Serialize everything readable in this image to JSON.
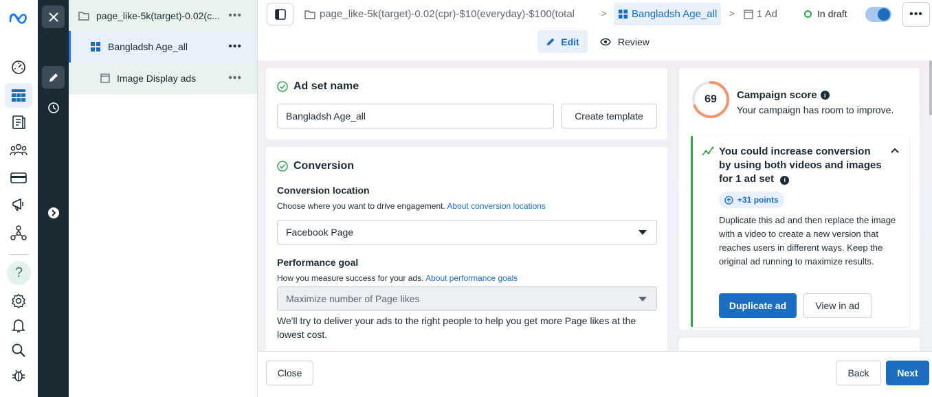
{
  "rail": {
    "help_glyph": "?",
    "icons": [
      "meta-logo-icon",
      "dashboard-icon",
      "ads-manager-icon",
      "pages-icon",
      "audiences-icon",
      "billing-icon",
      "campaign-icon",
      "business-icon",
      "help-icon",
      "settings-icon",
      "notifications-icon",
      "search-icon",
      "bug-report-icon"
    ]
  },
  "tree": {
    "campaign": "page_like-5k(target)-0.02(c...",
    "ad_set": "Bangladsh Age_all",
    "ad": "Image Display ads",
    "more_glyph": "•••"
  },
  "header": {
    "campaign_crumb": "page_like-5k(target)-0.02(cpr)-$10(everyday)-$100(total",
    "adset_crumb": "Bangladsh Age_all",
    "ad_crumb": "1 Ad",
    "separator": ">",
    "status": "In draft",
    "more_glyph": "•••",
    "edit_label": "Edit",
    "review_label": "Review"
  },
  "adset_name_section": {
    "title": "Ad set name",
    "value": "Bangladsh Age_all",
    "create_template_label": "Create template"
  },
  "conversion_section": {
    "title": "Conversion",
    "location_label": "Conversion location",
    "location_help": "Choose where you want to drive engagement.",
    "location_help_link": "About conversion locations",
    "location_value": "Facebook Page",
    "goal_label": "Performance goal",
    "goal_help": "How you measure success for your ads.",
    "goal_help_link": "About performance goals",
    "goal_value": "Maximize number of Page likes",
    "goal_description": "We'll try to deliver your ads to the right people to help you get more Page likes at the lowest cost."
  },
  "campaign_score": {
    "score": 69,
    "score_max": 100,
    "title": "Campaign score",
    "subtitle": "Your campaign has room to improve.",
    "recommendation": {
      "title": "You could increase conversion by using both videos and images for 1 ad set",
      "points": "+31 points",
      "body": "Duplicate this ad and then replace the image with a video to create a new version that reaches users in different ways. Keep the original ad running to maximize results.",
      "primary_label": "Duplicate ad",
      "secondary_label": "View in ad"
    }
  },
  "footer": {
    "close_label": "Close",
    "back_label": "Back",
    "next_label": "Next"
  },
  "colors": {
    "accent": "#1b6dc1",
    "dark_strip": "#1c2b33",
    "success": "#31a24c",
    "score_ring": "#f0956a"
  }
}
